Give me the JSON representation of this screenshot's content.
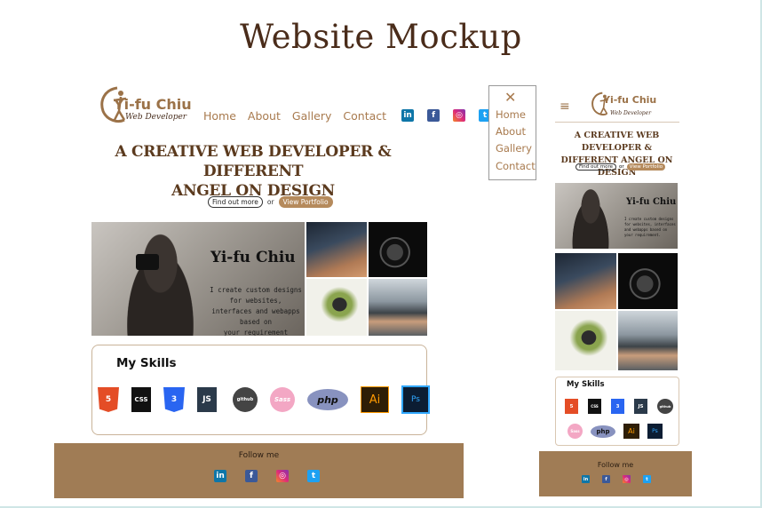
{
  "page_title": "Website Mockup",
  "desktop": {
    "logo": {
      "name": "Yi-fu Chiu",
      "subtitle": "Web Developer"
    },
    "nav": [
      "Home",
      "About",
      "Gallery",
      "Contact"
    ],
    "social_icons": [
      "linkedin-icon",
      "facebook-icon",
      "instagram-icon",
      "twitter-icon"
    ],
    "headline_line1": "A CREATIVE WEB DEVELOPER & DIFFERENT",
    "headline_line2": "ANGEL ON DESIGN",
    "cta_primary": "Find out more",
    "cta_or": "or",
    "cta_secondary": "View Portfolio",
    "hero_name": "Yi-fu Chiu",
    "hero_desc_1": "I create custom designs for websites,",
    "hero_desc_2": "interfaces and webapps based on",
    "hero_desc_3": "your requirement",
    "skills_title": "My Skills",
    "skills": [
      "5",
      "CSS",
      "3",
      "JS",
      "github",
      "Sass",
      "php",
      "Ai",
      "Ps"
    ],
    "footer_label": "Follow me"
  },
  "mobile_menu": {
    "close": "✕",
    "items": [
      "Home",
      "About",
      "Gallery",
      "Contact"
    ]
  },
  "phone": {
    "menu_icon": "≡",
    "logo_name": "Yi-fu Chiu",
    "logo_subtitle": "Web Developer",
    "headline_line1": "A CREATIVE WEB DEVELOPER &",
    "headline_line2": "DIFFERENT ANGEL ON DESIGN",
    "cta_primary": "Find out more",
    "cta_or": "or",
    "cta_secondary": "View Portfolio",
    "hero_name": "Yi-fu Chiu",
    "hero_desc": "I create custom designs for websites, interfaces and webapps based on your requirement.",
    "skills_title": "My Skills",
    "footer_label": "Follow me"
  },
  "colors": {
    "brand_brown": "#a07c55",
    "accent_tan": "#b58a5c",
    "heading_brown": "#5b3a1e"
  }
}
